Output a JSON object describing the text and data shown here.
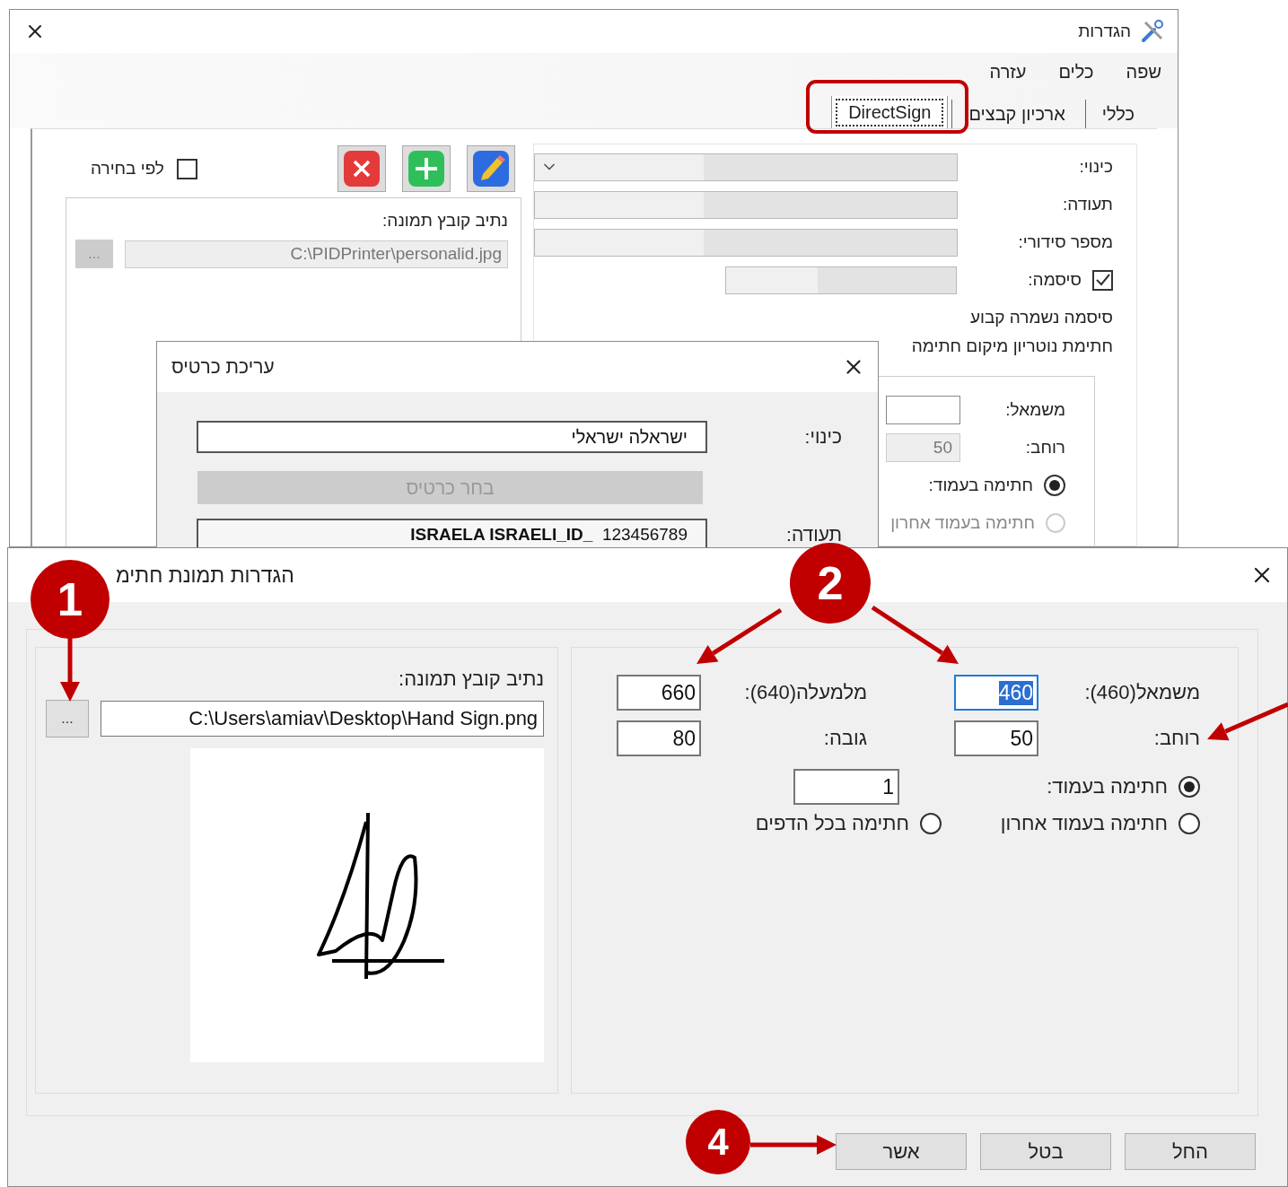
{
  "settings_window": {
    "title": "הגדרות",
    "menu": [
      "שפה",
      "כלים",
      "עזרה"
    ],
    "tabs": [
      {
        "label": "כללי",
        "selected": false
      },
      {
        "label": "ארכיון קבצים",
        "selected": false
      },
      {
        "label": "DirectSign",
        "selected": true
      }
    ],
    "form": {
      "fields": [
        {
          "label": "כינוי:",
          "kind": "dropdown"
        },
        {
          "label": "תעודה:",
          "kind": "text"
        },
        {
          "label": "מספר סידורי:",
          "kind": "text"
        },
        {
          "label": "סיסמה:",
          "kind": "password",
          "checked": true
        }
      ],
      "password_note": "סיסמה נשמרה קבוע",
      "notary_heading": "חתימת נוטריון מיקום חתימה",
      "position": {
        "left_label": "משמאל:",
        "width_label": "רוחב:",
        "width_value": "50",
        "options": [
          {
            "label": "חתימה בעמוד:",
            "selected": true,
            "disabled": false
          },
          {
            "label": "חתימה בעמוד אחרון",
            "selected": false,
            "disabled": true
          }
        ]
      }
    },
    "by_choice": {
      "label": "לפי בחירה",
      "checked": false
    },
    "image_path_label": "נתיב קובץ תמונה:",
    "image_path": "C:\\PIDPrinter\\personalid.jpg",
    "browse_button": "..."
  },
  "edit_card_dialog": {
    "title": "עריכת כרטיס",
    "name_label": "כינוי:",
    "name_value": "ישראלה ישראלי",
    "choose_card_button": "בחר כרטיס",
    "certificate_label": "תעודה:",
    "certificate_value": "**ISRAELA ISRAELI_ID_**  123456789"
  },
  "signature_image_dialog": {
    "title": "הגדרות תמונת חתימ",
    "image_path_label": "נתיב קובץ תמונה:",
    "image_path": "C:\\Users\\amiav\\Desktop\\Hand Sign.png",
    "browse_button": "...",
    "fields": [
      {
        "label": "משמאל(460):",
        "value": "460",
        "selected": true
      },
      {
        "label": "מלמעלה(640):",
        "value": "660",
        "selected": false
      },
      {
        "label": "רוחב:",
        "value": "50",
        "selected": false
      },
      {
        "label": "גובה:",
        "value": "80",
        "selected": false
      }
    ],
    "page_value": "1",
    "options": [
      {
        "label": "חתימה בעמוד:",
        "selected": true
      },
      {
        "label": "חתימה בעמוד אחרון",
        "selected": false
      },
      {
        "label": "חתימה בכל הדפים",
        "selected": false
      }
    ],
    "buttons": [
      "החל",
      "בטל",
      "אשר"
    ]
  },
  "callouts": [
    "1",
    "2",
    "4"
  ]
}
